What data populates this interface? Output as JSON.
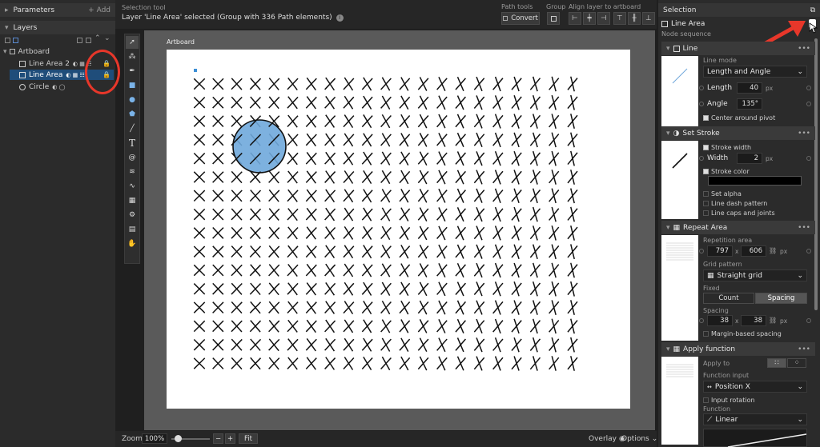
{
  "left": {
    "parameters_title": "Parameters",
    "add_label": "+ Add",
    "layers_title": "Layers",
    "layers": [
      {
        "name": "Artboard",
        "type": "artboard"
      },
      {
        "name": "Line Area 2",
        "type": "line",
        "locked": true
      },
      {
        "name": "Line Area",
        "type": "line",
        "locked": true,
        "selected": true
      },
      {
        "name": "Circle",
        "type": "circle"
      }
    ]
  },
  "top": {
    "tool_label": "Selection tool",
    "status": "Layer 'Line Area' selected (Group with 336 Path elements)",
    "path_tools": "Path tools",
    "convert": "Convert",
    "group": "Group",
    "align": "Align layer to artboard"
  },
  "canvas": {
    "artboard_label": "Artboard"
  },
  "bottom": {
    "zoom_label": "Zoom",
    "zoom_value": "100%",
    "zoom_minus": "−",
    "zoom_plus": "+",
    "fit": "Fit",
    "overlay": "Overlay",
    "options": "Options"
  },
  "right": {
    "selection_title": "Selection",
    "node_name": "Line Area",
    "node_sequence": "Node sequence",
    "line": {
      "title": "Line",
      "mode_label": "Line mode",
      "mode_value": "Length and Angle",
      "length_label": "Length",
      "length_value": "40",
      "length_unit": "px",
      "angle_label": "Angle",
      "angle_value": "135°",
      "center_label": "Center around pivot"
    },
    "stroke": {
      "title": "Set Stroke",
      "width_check": "Stroke width",
      "width_label": "Width",
      "width_value": "2",
      "width_unit": "px",
      "color_check": "Stroke color",
      "alpha": "Set alpha",
      "dash": "Line dash pattern",
      "caps": "Line caps and joints"
    },
    "repeat": {
      "title": "Repeat Area",
      "area_label": "Repetition area",
      "w": "797",
      "x": "x",
      "h": "606",
      "unit": "px",
      "grid_label": "Grid pattern",
      "grid_value": "Straight grid",
      "fixed_label": "Fixed",
      "count": "Count",
      "spacing_btn": "Spacing",
      "spacing_label": "Spacing",
      "sx": "38",
      "sy": "38",
      "margin": "Margin-based spacing"
    },
    "apply": {
      "title": "Apply function",
      "apply_to": "Apply to",
      "input_label": "Function input",
      "input_value": "Position X",
      "rotation": "Input rotation",
      "function_label": "Function",
      "function_value": "Linear"
    }
  },
  "colors": {
    "accent": "#3c8fd6",
    "circle_fill": "#6fa8dc",
    "annotation": "#e8372a"
  }
}
